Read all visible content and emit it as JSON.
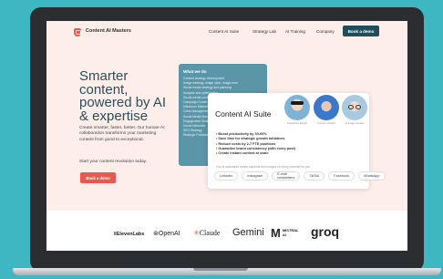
{
  "nav": {
    "logo": "Content AI Masters",
    "links": [
      "Content AI Suite",
      "Strategy Lab",
      "AI Training",
      "Company"
    ],
    "cta": "Book a demo"
  },
  "hero": {
    "title_lines": [
      "Smarter",
      "content,",
      "powered by AI",
      "& expertise"
    ],
    "description": "Create smarter, faster, better. Our human-AI collaboration transforms your marketing content from good to exceptional.",
    "subtext": "Start your content revolution today.",
    "cta": "Book a demo"
  },
  "services_card": {
    "title": "What we do",
    "items": [
      "Content strategy development",
      "Image strategy, image style, image tone",
      "Social media strategy and planning",
      "Analysis and optimization",
      "Social media content",
      "Campaign Content",
      "Influencer Marketing",
      "Crisis Management",
      "Social Media Management",
      "Engagement Strategy",
      "Social Networks",
      "SEO Strategy",
      "Strategic Positioning"
    ]
  },
  "suite_card": {
    "title": "Content AI Suite",
    "bullets": [
      "Boost productivity by 30-60%",
      "Save time for strategic growth initiatives",
      "Reduce costs by 2-7 FTE positions",
      "Guarantee brand consistency (with every post)",
      "Create instant content at scale"
    ],
    "note": "Our AI assistants create captions and images on every channel for you",
    "channels": [
      "LinkedIn",
      "Instagram",
      "E-mail newsletters",
      "TikTok",
      "Facebook",
      "WhatsApp"
    ],
    "avatars": [
      {
        "label": "Copywriter Expert",
        "color": "#7fb3d5"
      },
      {
        "label": "Content Creator",
        "color": "#3a78c9"
      },
      {
        "label": "AI Image Creator",
        "color": "#a8c9e0"
      }
    ]
  },
  "partners": [
    "ElevenLabs",
    "OpenAI",
    "Claude",
    "Gemini",
    "MISTRAL AI",
    "groq"
  ],
  "colors": {
    "accent": "#e85a4f",
    "dark_teal": "#1f4d5a",
    "heading": "#2e4e5a",
    "card_blue": "#5b95a8",
    "hero_bg": "#fdeeea",
    "backdrop": "#3fb7c2"
  }
}
